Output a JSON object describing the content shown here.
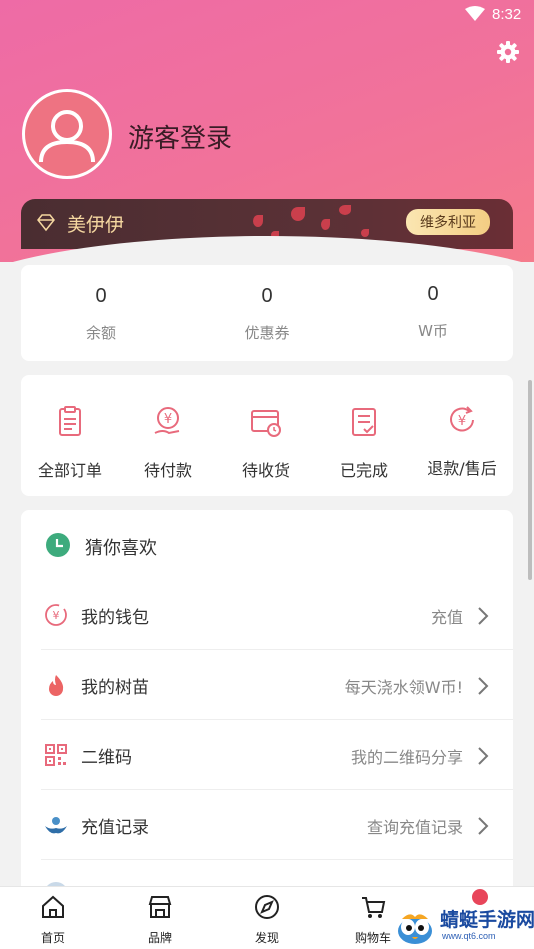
{
  "status_bar": {
    "time": "8:32"
  },
  "profile": {
    "login_text": "游客登录"
  },
  "vip": {
    "name": "美伊伊",
    "badge": "维多利亚"
  },
  "stats": [
    {
      "value": "0",
      "label": "余额"
    },
    {
      "value": "0",
      "label": "优惠券"
    },
    {
      "value": "0",
      "label": "W币"
    }
  ],
  "orders": [
    {
      "label": "全部订单",
      "icon": "order-list-icon"
    },
    {
      "label": "待付款",
      "icon": "pay-hand-icon"
    },
    {
      "label": "待收货",
      "icon": "delivery-clock-icon"
    },
    {
      "label": "已完成",
      "icon": "completed-doc-icon"
    },
    {
      "label": "退款/售后",
      "icon": "refund-icon"
    }
  ],
  "menu": {
    "heading": "猜你喜欢",
    "rows": [
      {
        "label": "我的钱包",
        "hint": "充值",
        "icon": "wallet-icon"
      },
      {
        "label": "我的树苗",
        "hint": "每天浇水领W币!",
        "icon": "flame-icon"
      },
      {
        "label": "二维码",
        "hint": "我的二维码分享",
        "icon": "qrcode-icon"
      },
      {
        "label": "充值记录",
        "hint": "查询充值记录",
        "icon": "recharge-record-icon"
      }
    ]
  },
  "tabs": [
    {
      "label": "首页",
      "icon": "home-icon"
    },
    {
      "label": "品牌",
      "icon": "store-icon"
    },
    {
      "label": "发现",
      "icon": "compass-icon"
    },
    {
      "label": "购物车",
      "icon": "cart-icon"
    }
  ],
  "watermark": {
    "text": "蜻蜓手游网",
    "sub": "www.qt6.com"
  },
  "colors": {
    "accent": "#e86a7c",
    "header_start": "#ee6ba6",
    "vip_bg": "#4a2d31",
    "vip_gold": "#f5d7a0"
  }
}
